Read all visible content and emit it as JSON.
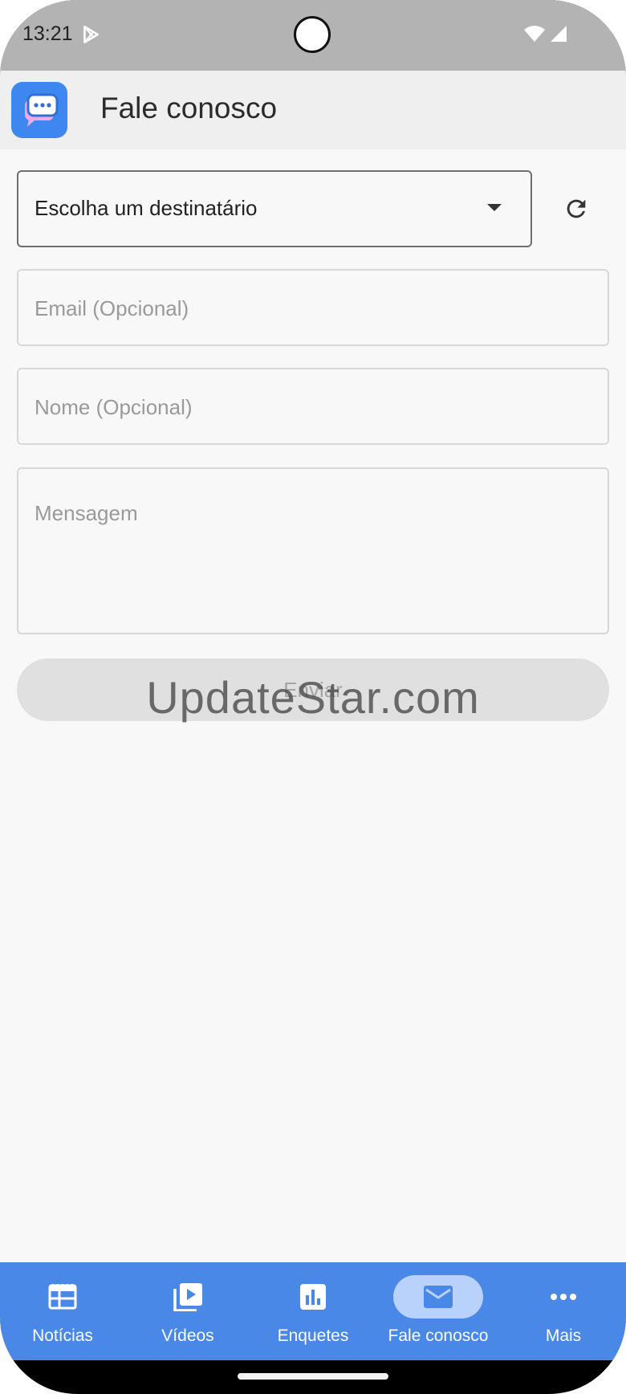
{
  "status_bar": {
    "time": "13:21",
    "icons": [
      "play-store-icon",
      "wifi-icon",
      "signal-icon"
    ]
  },
  "app_bar": {
    "title": "Fale conosco",
    "logo_icon": "chat-bubble-icon",
    "logo_color": "#3f87f0"
  },
  "form": {
    "recipient_select": {
      "selected_label": "Escolha um destinatário"
    },
    "refresh_icon": "refresh-icon",
    "email_placeholder": "Email (Opcional)",
    "email_value": "",
    "name_placeholder": "Nome (Opcional)",
    "name_value": "",
    "message_placeholder": "Mensagem",
    "message_value": "",
    "send_label": "Enviar"
  },
  "watermark": "UpdateStar.com",
  "bottom_nav": {
    "color": "#4a88e8",
    "active_color": "#b9d2fb",
    "items": [
      {
        "label": "Notícias",
        "icon": "news-icon",
        "active": false
      },
      {
        "label": "Vídeos",
        "icon": "video-library-icon",
        "active": false
      },
      {
        "label": "Enquetes",
        "icon": "poll-icon",
        "active": false
      },
      {
        "label": "Fale conosco",
        "icon": "mail-icon",
        "active": true
      },
      {
        "label": "Mais",
        "icon": "more-icon",
        "active": false
      }
    ]
  }
}
